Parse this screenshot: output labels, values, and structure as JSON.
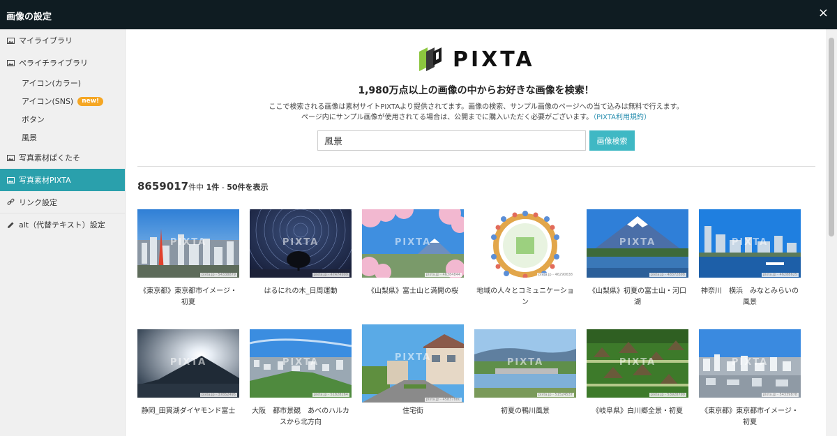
{
  "window": {
    "title": "画像の設定",
    "close_label": "×"
  },
  "sidebar": {
    "items": [
      {
        "label": "マイライブラリ",
        "icon": "image-icon"
      },
      {
        "label": "ペライチライブラリ",
        "icon": "image-icon"
      },
      {
        "label": "アイコン(カラー)"
      },
      {
        "label": "アイコン(SNS)",
        "badge": "new!"
      },
      {
        "label": "ボタン"
      },
      {
        "label": "風景"
      },
      {
        "label": "写真素材ぱくたそ",
        "icon": "image-icon"
      },
      {
        "label": "写真素材PIXTA",
        "icon": "image-icon",
        "active": true
      },
      {
        "label": "リンク設定",
        "icon": "link-icon"
      },
      {
        "label": "alt（代替テキスト）設定",
        "icon": "pencil-icon"
      }
    ]
  },
  "main": {
    "logo_text": "PIXTA",
    "headline": "1,980万点以上の画像の中からお好きな画像を検索！",
    "description_line1": "ここで検索される画像は素材サイトPIXTAより提供されてます。画像の検索、サンプル画像のページへの当て込みは無料で行えます。",
    "description_line2": "ページ内にサンプル画像が使用されてる場合は、公開までに購入いただく必要がございます。",
    "terms_link": "（PIXTA利用規約）",
    "search": {
      "value": "風景",
      "button_label": "画像検索"
    },
    "results": {
      "total": "8659017",
      "of": "件中",
      "from": "1件",
      "dash": " - ",
      "to": "50件を表示"
    },
    "watermark": "PIXTA",
    "items": [
      {
        "caption": "《東京都》東京都市イメージ・初夏",
        "id": "pixta.jp - 54338879"
      },
      {
        "caption": "はるにれの木_日周運動",
        "id": "pixta.jp - 47474999"
      },
      {
        "caption": "《山梨県》富士山と満開の桜",
        "id": "pixta.jp - 46384844"
      },
      {
        "caption": "地域の人々とコミュニケーション",
        "id": "pixta.jp - 46290638"
      },
      {
        "caption": "《山梨県》初夏の富士山・河口湖",
        "id": "pixta.jp - 48372898"
      },
      {
        "caption": "神奈川　横浜　みなとみらいの風景",
        "id": "pixta.jp - 46288625"
      },
      {
        "caption": "静岡_田貫湖ダイヤモンド富士",
        "id": "pixta.jp - 37852495"
      },
      {
        "caption": "大阪　都市景観　あべのハルカスから北方向",
        "id": "pixta.jp - 51828264"
      },
      {
        "caption": "住宅街",
        "id": "pixta.jp - 45837880"
      },
      {
        "caption": "初夏の鴨川風景",
        "id": "pixta.jp - 51524537"
      },
      {
        "caption": "《岐阜県》白川郷全景・初夏",
        "id": "pixta.jp - 53928799"
      },
      {
        "caption": "《東京都》東京都市イメージ・初夏",
        "id": "pixta.jp - 54339878"
      }
    ]
  }
}
